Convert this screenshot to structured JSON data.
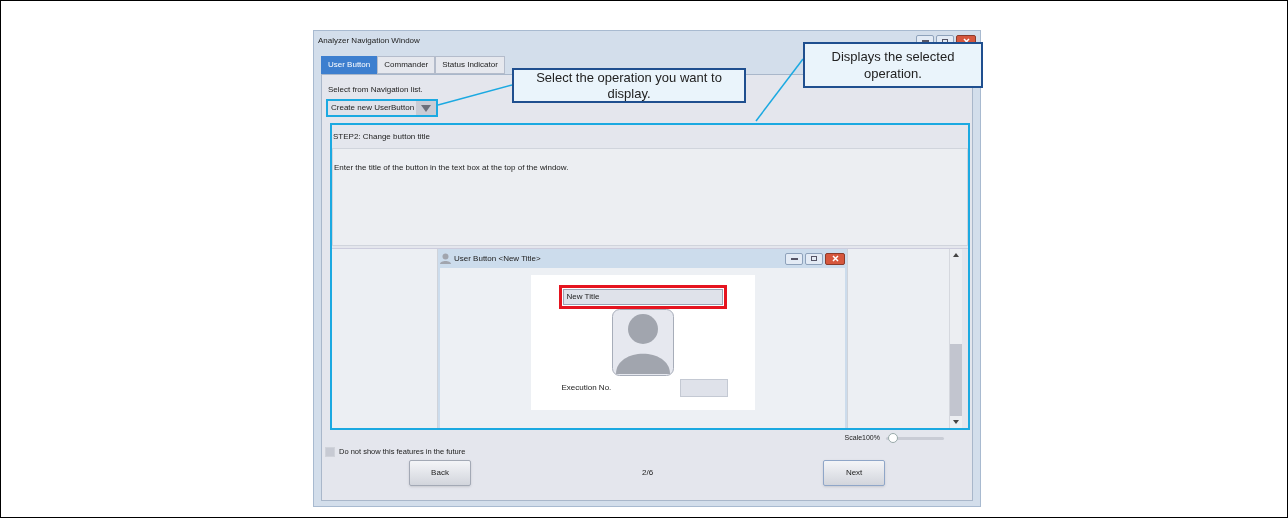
{
  "window": {
    "title": "Analyzer Navigation Window"
  },
  "tabs": [
    {
      "label": "User Button",
      "selected": true
    },
    {
      "label": "Commander",
      "selected": false
    },
    {
      "label": "Status Indicator",
      "selected": false
    }
  ],
  "navigation": {
    "label": "Select from Navigation list.",
    "value": "Create new UserButton"
  },
  "step": {
    "title": "STEP2: Change button title",
    "description": "Enter the title of the button in the text box at the top of the window."
  },
  "preview": {
    "title": "User Button <New Title>",
    "title_field": "New Title",
    "execution_label": "Execution No."
  },
  "scale": {
    "label": "Scale100%",
    "level": 0.05
  },
  "dont_show": {
    "label": "Do not show this features in the future",
    "checked": false
  },
  "footer": {
    "back": "Back",
    "page": "2/6",
    "next": "Next"
  },
  "callouts": [
    {
      "text": "Select the operation you want to display."
    },
    {
      "text": "Displays the selected operation."
    }
  ]
}
